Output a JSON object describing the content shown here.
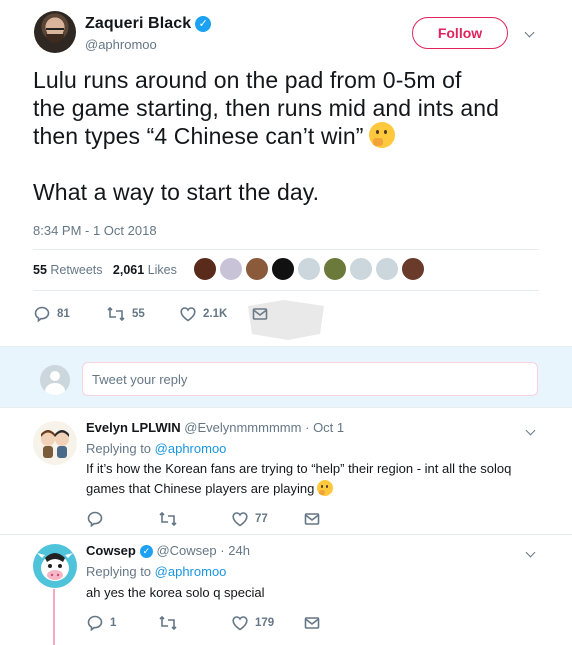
{
  "main_tweet": {
    "author_name": "Zaqueri Black",
    "author_handle": "@aphromoo",
    "follow_label": "Follow",
    "text_lines": [
      "Lulu runs around on the pad from 0-5m of",
      "the game starting, then runs mid and ints and",
      "then types “4 Chinese can’t win”"
    ],
    "text_line_4": "What a way to start the day.",
    "emoji": "thinking-face-emoji",
    "timestamp": "8:34 PM - 1 Oct 2018",
    "retweets_count": "55",
    "retweets_label": "Retweets",
    "likes_count": "2,061",
    "likes_label": "Likes",
    "liker_avatar_colors": [
      "#5a2a1a",
      "#c9c3d8",
      "#8a5a3a",
      "#111111",
      "#ccd6dd",
      "#6b7a3a",
      "#ccd6dd",
      "#ccd6dd",
      "#6a3a2a"
    ],
    "actions": {
      "replies": "81",
      "retweets": "55",
      "likes": "2.1K"
    }
  },
  "reply_box": {
    "placeholder": "Tweet your reply"
  },
  "replies": [
    {
      "name": "Evelyn LPLWIN",
      "handle": "@Evelynmmmmmm",
      "date": "Oct 1",
      "replying_to_label": "Replying to",
      "replying_to": "@aphromoo",
      "text_line1": "If it’s how the Korean fans are trying to “help” their region - int all the soloq",
      "text_line2": "games that Chinese players are playing",
      "actions": {
        "replies": "",
        "retweets": "",
        "likes": "77"
      }
    },
    {
      "name": "Cowsep",
      "handle": "@Cowsep",
      "date": "24h",
      "replying_to_label": "Replying to",
      "replying_to": "@aphromoo",
      "text_line1": "ah yes the korea solo q special",
      "actions": {
        "replies": "1",
        "retweets": "",
        "likes": "179"
      }
    }
  ],
  "colors": {
    "accent_red": "#e0245e",
    "link_blue": "#1b95e0",
    "verified_blue": "#1da1f2",
    "muted_gray": "#657786",
    "reply_bar_bg": "#e8f5fd",
    "thread_line": "#f4aac3"
  }
}
